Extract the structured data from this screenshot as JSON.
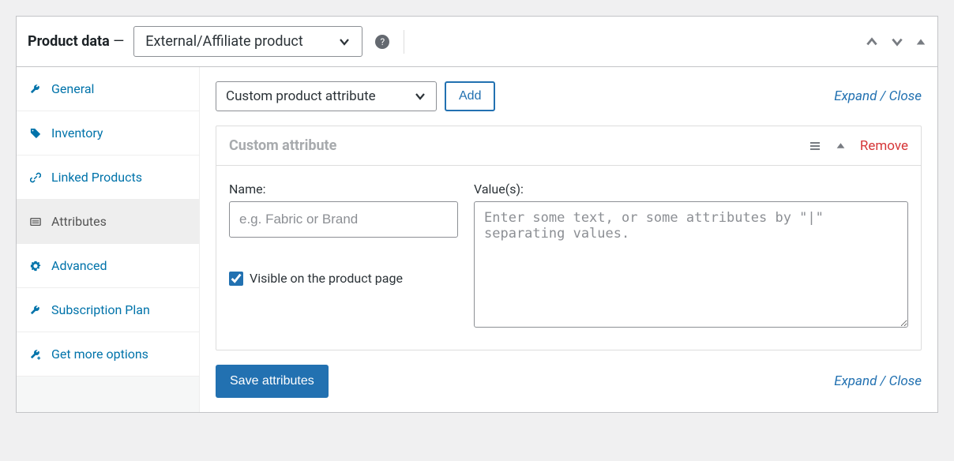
{
  "header": {
    "title": "Product data",
    "dash": "—",
    "product_type": "External/Affiliate product"
  },
  "tabs": [
    {
      "key": "general",
      "label": "General"
    },
    {
      "key": "inventory",
      "label": "Inventory"
    },
    {
      "key": "linked",
      "label": "Linked Products"
    },
    {
      "key": "attributes",
      "label": "Attributes"
    },
    {
      "key": "advanced",
      "label": "Advanced"
    },
    {
      "key": "subscription",
      "label": "Subscription Plan"
    },
    {
      "key": "getmore",
      "label": "Get more options"
    }
  ],
  "toolbar": {
    "attr_type": "Custom product attribute",
    "add_label": "Add",
    "expand_label": "Expand",
    "close_label": "Close"
  },
  "attribute": {
    "title": "Custom attribute",
    "remove_label": "Remove",
    "name_label": "Name:",
    "name_placeholder": "e.g. Fabric or Brand",
    "name_value": "",
    "values_label": "Value(s):",
    "values_placeholder": "Enter some text, or some attributes by \"|\" separating values.",
    "values_value": "",
    "visible_label": "Visible on the product page",
    "visible_checked": true
  },
  "footer": {
    "save_label": "Save attributes",
    "expand_label": "Expand",
    "close_label": "Close"
  }
}
